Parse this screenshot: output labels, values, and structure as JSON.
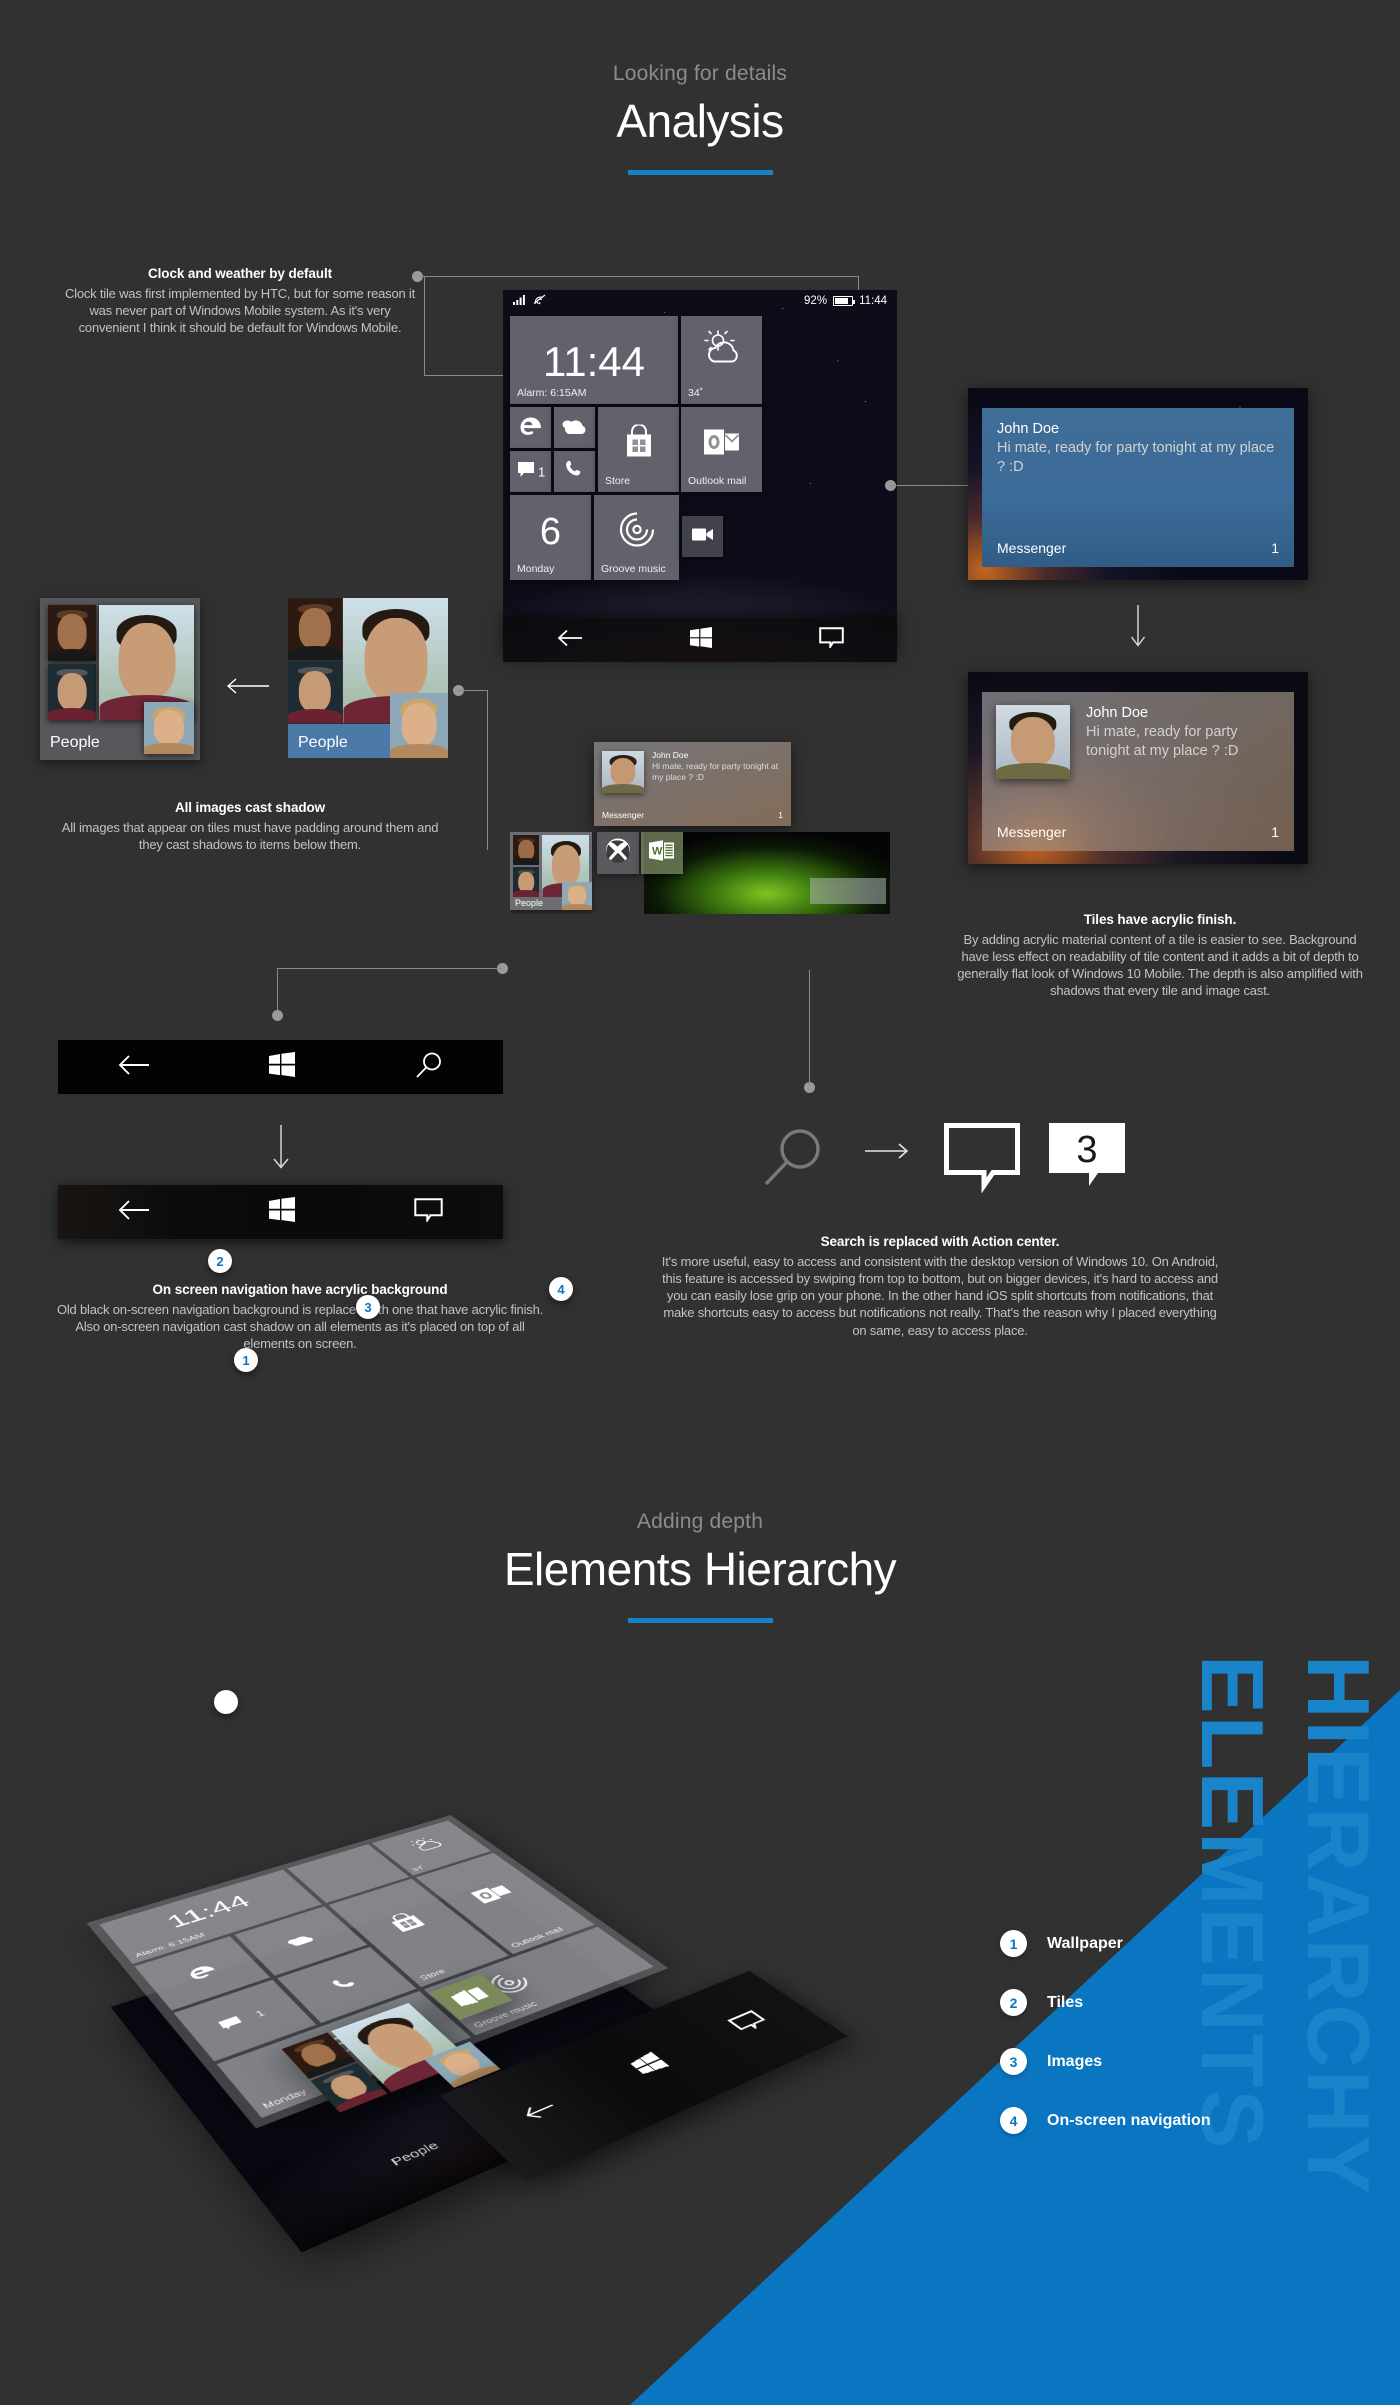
{
  "sections": {
    "analysis": {
      "kicker": "Looking for details",
      "title": "Analysis"
    },
    "hierarchy": {
      "kicker": "Adding depth",
      "title": "Elements Hierarchy"
    }
  },
  "annotations": {
    "clock": {
      "title": "Clock and weather by default",
      "body": "Clock tile was first implemented by HTC, but for some reason it was never part of Windows Mobile system. As it's very convenient I think it should be default for Windows Mobile."
    },
    "images_shadow": {
      "title": "All images cast shadow",
      "body": "All images that appear on tiles must have padding around them and they cast shadows to items below them."
    },
    "acrylic_tiles": {
      "title": "Tiles have acrylic finish.",
      "body": "By adding acrylic material content of a tile is easier to see. Background have less effect on readability of tile content and it adds a bit of depth to generally flat look of Windows 10 Mobile. The depth is also amplified with shadows that every tile and image cast."
    },
    "nav_acrylic": {
      "title": "On screen navigation have acrylic background",
      "body": "Old black on-screen navigation background is replaced with one that have acrylic finish. Also on-screen navigation cast shadow on all elements as it's placed on top of all elements on screen."
    },
    "action_center": {
      "title": "Search is replaced with Action center.",
      "body": "It's more useful, easy to access and consistent with the desktop version of Windows 10. On Android, this feature is accessed by swiping from top to bottom, but on bigger devices, it's hard to access and you can easily lose grip on your phone. In the other hand iOS split shortcuts from notifications, that make shortcuts easy to access but notifications not really. That's the reason why I placed everything on same, easy to access place."
    }
  },
  "phone": {
    "status": {
      "battery": "92%",
      "time": "11:44",
      "signal_icon": "signal-bars-icon",
      "wifi_icon": "wifi-icon",
      "battery_icon": "battery-icon"
    },
    "tiles": {
      "clock": {
        "time": "11:44",
        "alarm": "Alarm: 6:15AM"
      },
      "weather": {
        "temp": "34˚",
        "icon": "sun-cloud-icon"
      },
      "edge": {
        "icon": "edge-icon"
      },
      "onedrive": {
        "icon": "onedrive-cloud-icon"
      },
      "messaging": {
        "icon": "message-icon",
        "count": "1"
      },
      "phone": {
        "icon": "phone-handset-icon"
      },
      "store": {
        "label": "Store",
        "icon": "store-bag-icon"
      },
      "outlook": {
        "label": "Outlook mail",
        "icon": "outlook-icon"
      },
      "calendar": {
        "day_number": "6",
        "label": "Monday"
      },
      "groove": {
        "label": "Groove music",
        "icon": "groove-music-icon"
      },
      "camera": {
        "icon": "video-camera-icon"
      },
      "people": {
        "label": "People"
      },
      "xbox": {
        "icon": "xbox-icon"
      },
      "word": {
        "icon": "word-icon"
      }
    },
    "notification": {
      "name": "John Doe",
      "message": "Hi mate, ready for party tonight at my place ? :D",
      "app": "Messenger",
      "count": "1"
    },
    "nav": {
      "back_icon": "back-arrow-icon",
      "start_icon": "windows-logo-icon",
      "action_icon": "action-center-icon"
    }
  },
  "people_tiles": {
    "label": "People",
    "before_state": "flat-blue",
    "after_state": "acrylic-grey"
  },
  "notification_cards": {
    "top": {
      "name": "John Doe",
      "message": "Hi mate, ready for party tonight at my place ? :D",
      "app": "Messenger",
      "count": "1"
    },
    "bottom": {
      "name": "John Doe",
      "message": "Hi mate, ready for party tonight at my place ? :D",
      "app": "Messenger",
      "count": "1"
    }
  },
  "navbars": {
    "old": {
      "back_icon": "back-arrow-icon",
      "start_icon": "windows-logo-icon",
      "right_icon": "search-icon"
    },
    "new": {
      "back_icon": "back-arrow-icon",
      "start_icon": "windows-logo-icon",
      "right_icon": "action-center-icon"
    }
  },
  "search_replace": {
    "from_icon": "search-icon",
    "arrow_icon": "right-arrow-icon",
    "to_icon": "action-center-icon",
    "to_badge_icon": "action-center-badge-icon",
    "badge_count": "3"
  },
  "hierarchy_legend": [
    {
      "num": "1",
      "label": "Wallpaper"
    },
    {
      "num": "2",
      "label": "Tiles"
    },
    {
      "num": "3",
      "label": "Images"
    },
    {
      "num": "4",
      "label": "On-screen navigation"
    }
  ],
  "ghost_text": {
    "line1": "ELEMENTS",
    "line2": "HIERARCHY"
  },
  "colors": {
    "background": "#313131",
    "accent": "#1880c9",
    "blue_band": "#0a76c2",
    "ghost_blue": "#1a84cb",
    "nav_black": "#030303"
  }
}
